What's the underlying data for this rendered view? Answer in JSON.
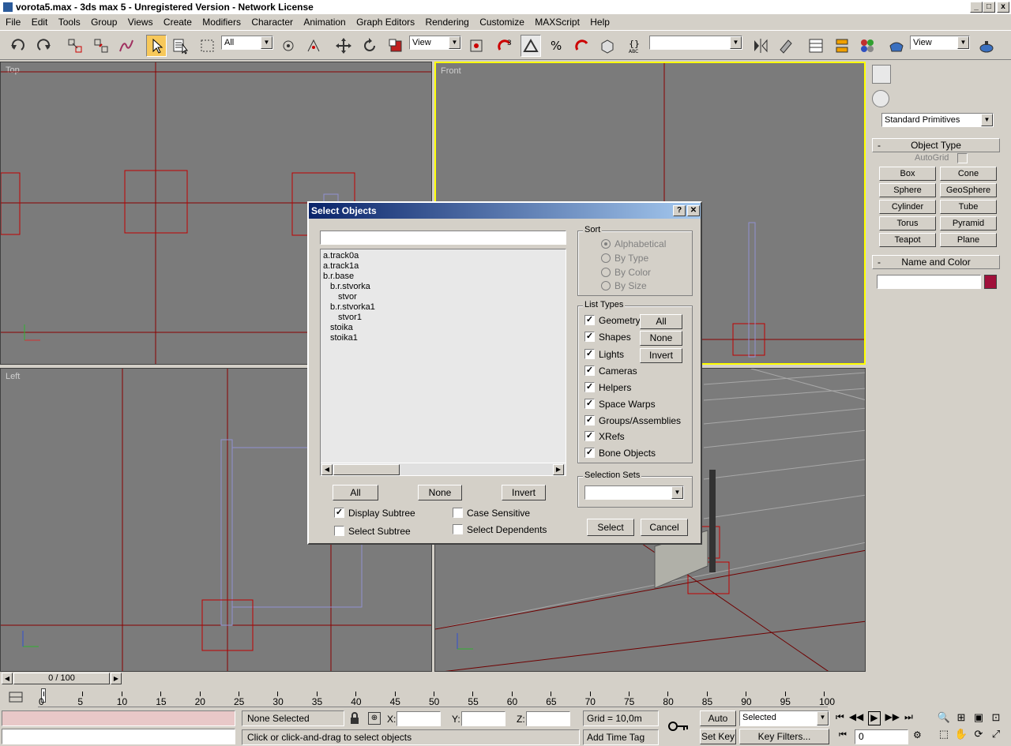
{
  "window": {
    "title": "vorota5.max - 3ds max 5 - Unregistered Version - Network License"
  },
  "menu": [
    "File",
    "Edit",
    "Tools",
    "Group",
    "Views",
    "Create",
    "Modifiers",
    "Character",
    "Animation",
    "Graph Editors",
    "Rendering",
    "Customize",
    "MAXScript",
    "Help"
  ],
  "toolbar": {
    "filter_value": "All",
    "refcoord_value": "View",
    "named_sel_value": "",
    "view_value2": "View"
  },
  "viewports": {
    "top": "Top",
    "front": "Front",
    "left": "Left"
  },
  "command_panel": {
    "category": "Standard Primitives",
    "object_type_title": "Object Type",
    "autogrid": "AutoGrid",
    "buttons": [
      "Box",
      "Cone",
      "Sphere",
      "GeoSphere",
      "Cylinder",
      "Tube",
      "Torus",
      "Pyramid",
      "Teapot",
      "Plane"
    ],
    "name_color_title": "Name and Color",
    "swatch_color": "#a0103a"
  },
  "dialog": {
    "title": "Select Objects",
    "help": "?",
    "close": "✕",
    "search_value": "",
    "items": [
      {
        "label": "a.track0a",
        "indent": 0
      },
      {
        "label": "a.track1a",
        "indent": 0
      },
      {
        "label": "b.r.base",
        "indent": 0
      },
      {
        "label": "b.r.stvorka",
        "indent": 1
      },
      {
        "label": "stvor",
        "indent": 2
      },
      {
        "label": "b.r.stvorka1",
        "indent": 1
      },
      {
        "label": "stvor1",
        "indent": 2
      },
      {
        "label": "stoika",
        "indent": 1
      },
      {
        "label": "stoika1",
        "indent": 1
      }
    ],
    "btn_all": "All",
    "btn_none": "None",
    "btn_invert": "Invert",
    "display_subtree": "Display Subtree",
    "select_subtree": "Select Subtree",
    "case_sensitive": "Case Sensitive",
    "select_dependents": "Select Dependents",
    "sort_title": "Sort",
    "sort_options": [
      "Alphabetical",
      "By Type",
      "By Color",
      "By Size"
    ],
    "list_types_title": "List Types",
    "list_types": [
      "Geometry",
      "Shapes",
      "Lights",
      "Cameras",
      "Helpers",
      "Space Warps",
      "Groups/Assemblies",
      "XRefs",
      "Bone Objects"
    ],
    "lt_all": "All",
    "lt_none": "None",
    "lt_invert": "Invert",
    "selection_sets_title": "Selection Sets",
    "select": "Select",
    "cancel": "Cancel"
  },
  "timeline": {
    "slider": "0 / 100",
    "ticks": [
      "0",
      "5",
      "10",
      "15",
      "20",
      "25",
      "30",
      "35",
      "40",
      "45",
      "50",
      "55",
      "60",
      "65",
      "70",
      "75",
      "80",
      "85",
      "90",
      "95",
      "100"
    ]
  },
  "status": {
    "selected": "None Selected",
    "x_label": "X:",
    "y_label": "Y:",
    "z_label": "Z:",
    "grid": "Grid = 10,0m",
    "auto_key": "Auto Key",
    "set_key": "Set Key",
    "key_mode": "Selected",
    "key_filters": "Key Filters...",
    "frame": "0",
    "prompt": "Click or click-and-drag to select objects",
    "add_time_tag": "Add Time Tag"
  }
}
